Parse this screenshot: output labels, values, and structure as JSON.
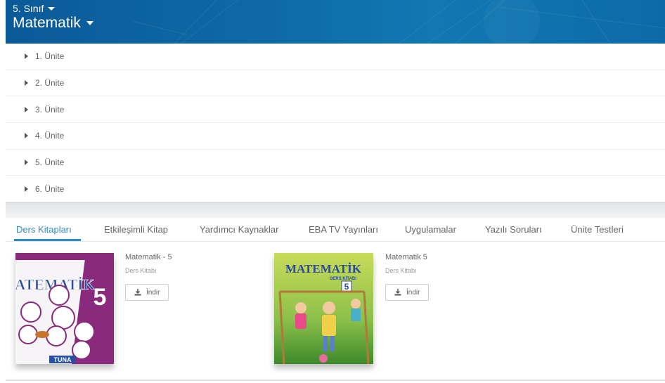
{
  "header": {
    "grade": "5. Sınıf",
    "subject": "Matematik"
  },
  "units": [
    {
      "label": "1. Ünite"
    },
    {
      "label": "2. Ünite"
    },
    {
      "label": "3. Ünite"
    },
    {
      "label": "4. Ünite"
    },
    {
      "label": "5. Ünite"
    },
    {
      "label": "6. Ünite"
    }
  ],
  "tabs": [
    {
      "label": "Ders Kitapları",
      "active": true
    },
    {
      "label": "Etkileşimli Kitap",
      "active": false
    },
    {
      "label": "Yardımcı Kaynaklar",
      "active": false
    },
    {
      "label": "EBA TV Yayınları",
      "active": false
    },
    {
      "label": "Uygulamalar",
      "active": false
    },
    {
      "label": "Yazılı Soruları",
      "active": false
    },
    {
      "label": "Ünite Testleri",
      "active": false
    }
  ],
  "books": [
    {
      "title": "Matematik - 5",
      "type": "Ders Kitabı",
      "download_label": "İndir",
      "cover_title": "MATEMATİK",
      "cover_number": "5",
      "cover_publisher": "TUNA"
    },
    {
      "title": "Matematik 5",
      "type": "Ders Kitabı",
      "download_label": "İndir",
      "cover_title": "MATEMATİK",
      "cover_number": "5",
      "cover_subtitle": "DERS KİTABI"
    }
  ],
  "colors": {
    "header_bg": "#0e6aa6",
    "accent": "#2d8ac7"
  }
}
